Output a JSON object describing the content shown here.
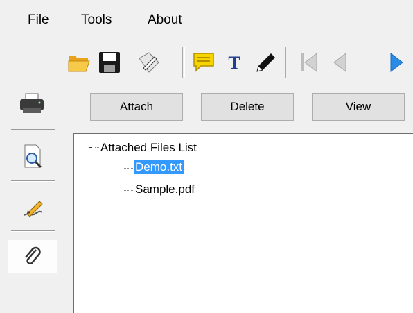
{
  "menu": {
    "file": "File",
    "tools": "Tools",
    "about": "About"
  },
  "toolbar": {
    "icons": [
      "open-folder-icon",
      "save-icon",
      "sign-icon",
      "comment-icon",
      "text-icon",
      "pen-icon",
      "first-page-icon",
      "previous-page-icon",
      "next-page-icon"
    ]
  },
  "sidebar": {
    "icons": [
      "printer-icon",
      "preview-icon",
      "signature-icon",
      "attachment-icon"
    ]
  },
  "buttons": {
    "attach": "Attach",
    "delete": "Delete",
    "view": "View"
  },
  "tree": {
    "root": "Attached Files List",
    "items": [
      "Demo.txt",
      "Sample.pdf"
    ],
    "selected": "Demo.txt"
  },
  "colors": {
    "selection": "#3399ff",
    "comment": "#f5d400",
    "text_tool": "#1f3f8c",
    "folder": "#f2b632"
  }
}
